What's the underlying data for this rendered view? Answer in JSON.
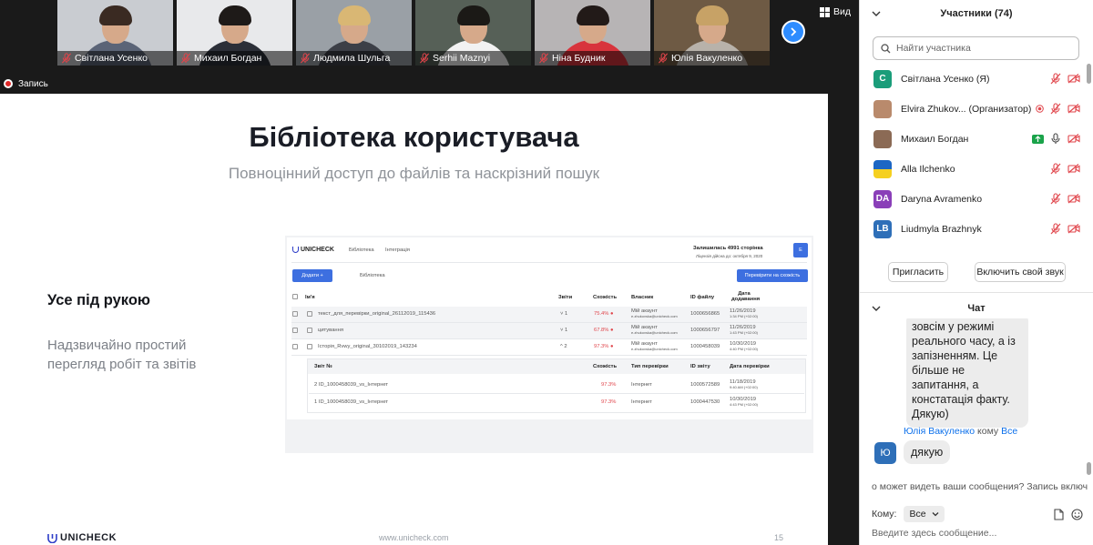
{
  "video_strip": {
    "tiles": [
      {
        "name": "Світлана Усенко",
        "bg": "#c9ccd1",
        "hair": "#3a2a22",
        "body": "#5b6477"
      },
      {
        "name": "Михаил Богдан",
        "bg": "#e8e9eb",
        "hair": "#1e1a18",
        "body": "#2c2f38"
      },
      {
        "name": "Людмила Шульга",
        "bg": "#9aa0a6",
        "hair": "#d9b774",
        "body": "#3c3f47"
      },
      {
        "name": "Serhii Maznyi",
        "bg": "#566057",
        "hair": "#1b1916",
        "body": "#f2f2f2"
      },
      {
        "name": "Ніна Будник",
        "bg": "#b7b4b5",
        "hair": "#221a18",
        "body": "#d8343d"
      },
      {
        "name": "Юлія Вакуленко",
        "bg": "#6e5a44",
        "hair": "#c7a266",
        "body": "#b8b2aa"
      }
    ],
    "view_label": "Вид"
  },
  "recording": {
    "label": "Запись"
  },
  "slide": {
    "title": "Бібліотека користувача",
    "subtitle": "Повноцінний доступ до файлів та наскрізний пошук",
    "left_heading": "Усе під рукою",
    "left_text": "Надзвичайно простий перегляд робіт та звітів",
    "footer_logo": "UNICHECK",
    "footer_url": "www.unicheck.com",
    "page_number": "15",
    "mock": {
      "logo": "UNICHECK",
      "nav": [
        "Бібліотека",
        "Інтеграція"
      ],
      "remaining": "Залишилась 4991 сторінка",
      "license": "Ліцензія дійсна до: октября 9, 2020",
      "add_button": "Додати",
      "breadcrumb": "Бібліотека",
      "check_button": "Перевірити на схожість",
      "columns": [
        "Ім'я",
        "Звіти",
        "Схожість",
        "Власник",
        "ID файлу",
        "Дата додавання"
      ],
      "rows": [
        {
          "name": "текст_для_перевірки_original_26112019_115436",
          "reports": "1",
          "similarity": "75.4%",
          "owner": "Мій акаунт",
          "owner_email": "e.zhukovska@unicheck.com",
          "file_id": "1000656865",
          "date": "11/26/2019",
          "time": "1:34 PM (+02:00)"
        },
        {
          "name": "цитування",
          "reports": "1",
          "similarity": "67.8%",
          "owner": "Мій акаунт",
          "owner_email": "e.zhukovska@unicheck.com",
          "file_id": "1000656797",
          "date": "11/26/2019",
          "time": "1:43 PM (+02:00)"
        },
        {
          "name": "Історія_Rvwy_original_30102019_143234",
          "reports": "2",
          "similarity": "97.3%",
          "owner": "Мій акаунт",
          "owner_email": "e.zhukovska@unicheck.com",
          "file_id": "1000458039",
          "date": "10/30/2019",
          "time": "4:40 PM (+02:00)"
        }
      ],
      "sub_columns": [
        "Звіт №",
        "Схожість",
        "Тип перевірки",
        "ID звіту",
        "Дата перевірки"
      ],
      "sub_rows": [
        {
          "name": "2 ID_1000458039_vs_Інтернет",
          "similarity": "97.3%",
          "type": "Інтернет",
          "report_id": "1000572589",
          "date": "11/18/2019",
          "time": "9:40 AM (+02:00)"
        },
        {
          "name": "1 ID_1000458039_vs_Інтернет",
          "similarity": "97.3%",
          "type": "Інтернет",
          "report_id": "1000447530",
          "date": "10/30/2019",
          "time": "4:43 PM (+02:00)"
        }
      ]
    }
  },
  "participants": {
    "header": "Участники (74)",
    "search_placeholder": "Найти участника",
    "list": [
      {
        "initials": "С",
        "color": "#1a9d7a",
        "name": "Світлана Усенко (Я)",
        "mic": "muted",
        "video": "off"
      },
      {
        "initials": "",
        "color": "#b98a6c",
        "name": "Elvira Zhukov... (Организатор)",
        "mic": "muted",
        "video": "off",
        "recording": true
      },
      {
        "initials": "",
        "color": "#8b6a55",
        "name": "Михаил Богдан",
        "mic": "on",
        "video": "off",
        "sharing": true
      },
      {
        "initials": "",
        "color": "#1c66c4",
        "name": "Alla Ilchenko",
        "mic": "muted",
        "video": "off"
      },
      {
        "initials": "DA",
        "color": "#8a3fb8",
        "name": "Daryna Avramenko",
        "mic": "muted",
        "video": "off"
      },
      {
        "initials": "LB",
        "color": "#2e6fb8",
        "name": "Liudmyla Brazhnyk",
        "mic": "muted",
        "video": "off"
      },
      {
        "initials": "",
        "color": "#1a9d7a",
        "name": "",
        "mic": "muted",
        "video": "off"
      }
    ],
    "invite_button": "Пригласить",
    "unmute_button": "Включить свой звук"
  },
  "chat": {
    "header": "Чат",
    "message1": "зовсім у режимі реального часу, а із запізненням. Це більше не запитання, а констатація факту. Дякую)",
    "message2_sender": "Юлія Вакуленко",
    "message2_to_word": "кому",
    "message2_recipient": "Все",
    "message2_avatar": "Ю",
    "message2_text": "дякую",
    "visibility_note": "о может видеть ваши сообщения? Запись включе",
    "to_label": "Кому:",
    "to_value": "Все",
    "input_placeholder": "Введите здесь сообщение..."
  },
  "colors": {
    "accent": "#2d8cff",
    "muted_red": "#e0454b",
    "link_blue": "#0e71eb"
  }
}
